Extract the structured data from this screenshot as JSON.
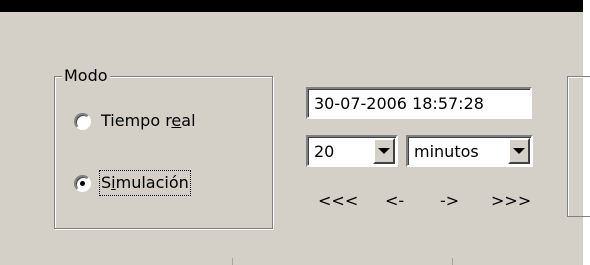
{
  "mode_group": {
    "title": "Modo",
    "options": [
      {
        "label_before": "Tiempo r",
        "mnemonic": "e",
        "label_after": "al",
        "selected": false
      },
      {
        "label_before": "S",
        "mnemonic": "i",
        "label_after": "mulación",
        "selected": true
      }
    ]
  },
  "datetime_field": {
    "value": "30-07-2006 18:57:28"
  },
  "interval": {
    "amount": "20",
    "unit": "minutos"
  },
  "navigation": {
    "first": "<<<",
    "prev": "<-",
    "next": "->",
    "last": ">>>"
  },
  "colors": {
    "panel": "#d4d0c8",
    "topbar": "#000000",
    "field": "#ffffff"
  }
}
